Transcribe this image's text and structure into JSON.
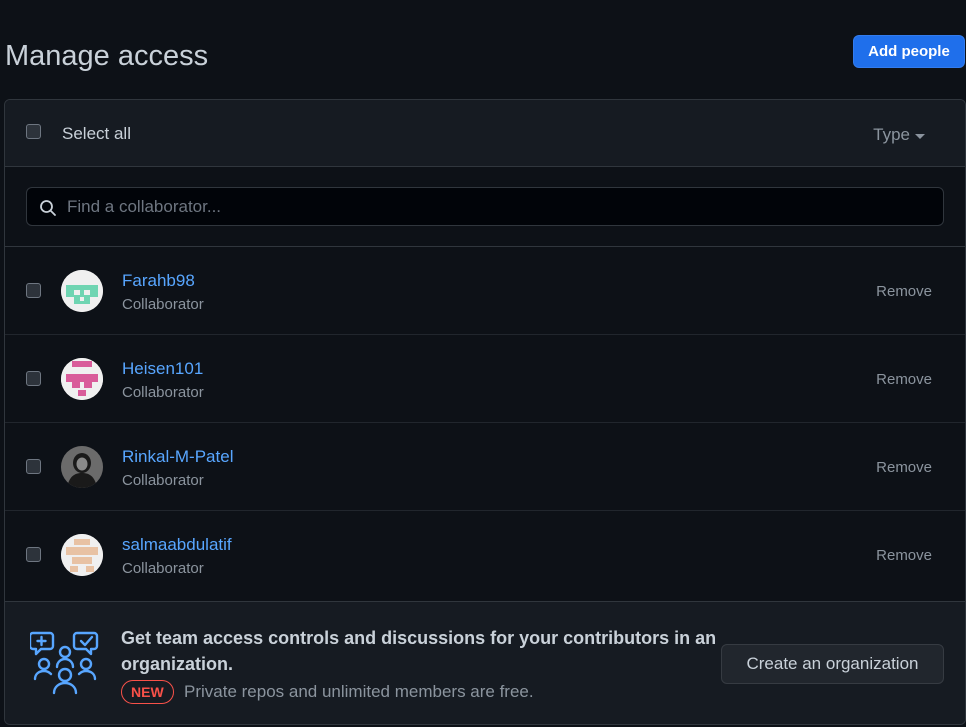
{
  "page": {
    "title": "Manage access"
  },
  "actions": {
    "add_people_label": "Add people"
  },
  "list_header": {
    "select_all_label": "Select all",
    "type_filter_label": "Type"
  },
  "search": {
    "placeholder": "Find a collaborator..."
  },
  "collaborators": [
    {
      "name": "Farahb98",
      "role": "Collaborator",
      "remove_label": "Remove",
      "avatar_color": "#6fd5b2"
    },
    {
      "name": "Heisen101",
      "role": "Collaborator",
      "remove_label": "Remove",
      "avatar_color": "#d95c9a"
    },
    {
      "name": "Rinkal-M-Patel",
      "role": "Collaborator",
      "remove_label": "Remove",
      "avatar_color": "#1a1a1a"
    },
    {
      "name": "salmaabdulatif",
      "role": "Collaborator",
      "remove_label": "Remove",
      "avatar_color": "#e8c2a4"
    }
  ],
  "org_banner": {
    "title": "Get team access controls and discussions for your contributors in an organization.",
    "badge": "NEW",
    "subtitle": "Private repos and unlimited members are free.",
    "button_label": "Create an organization",
    "icon_color": "#58a6ff"
  },
  "colors": {
    "background": "#0d1117",
    "link": "#58a6ff",
    "primary_button": "#1f6feb",
    "badge": "#f85149"
  }
}
